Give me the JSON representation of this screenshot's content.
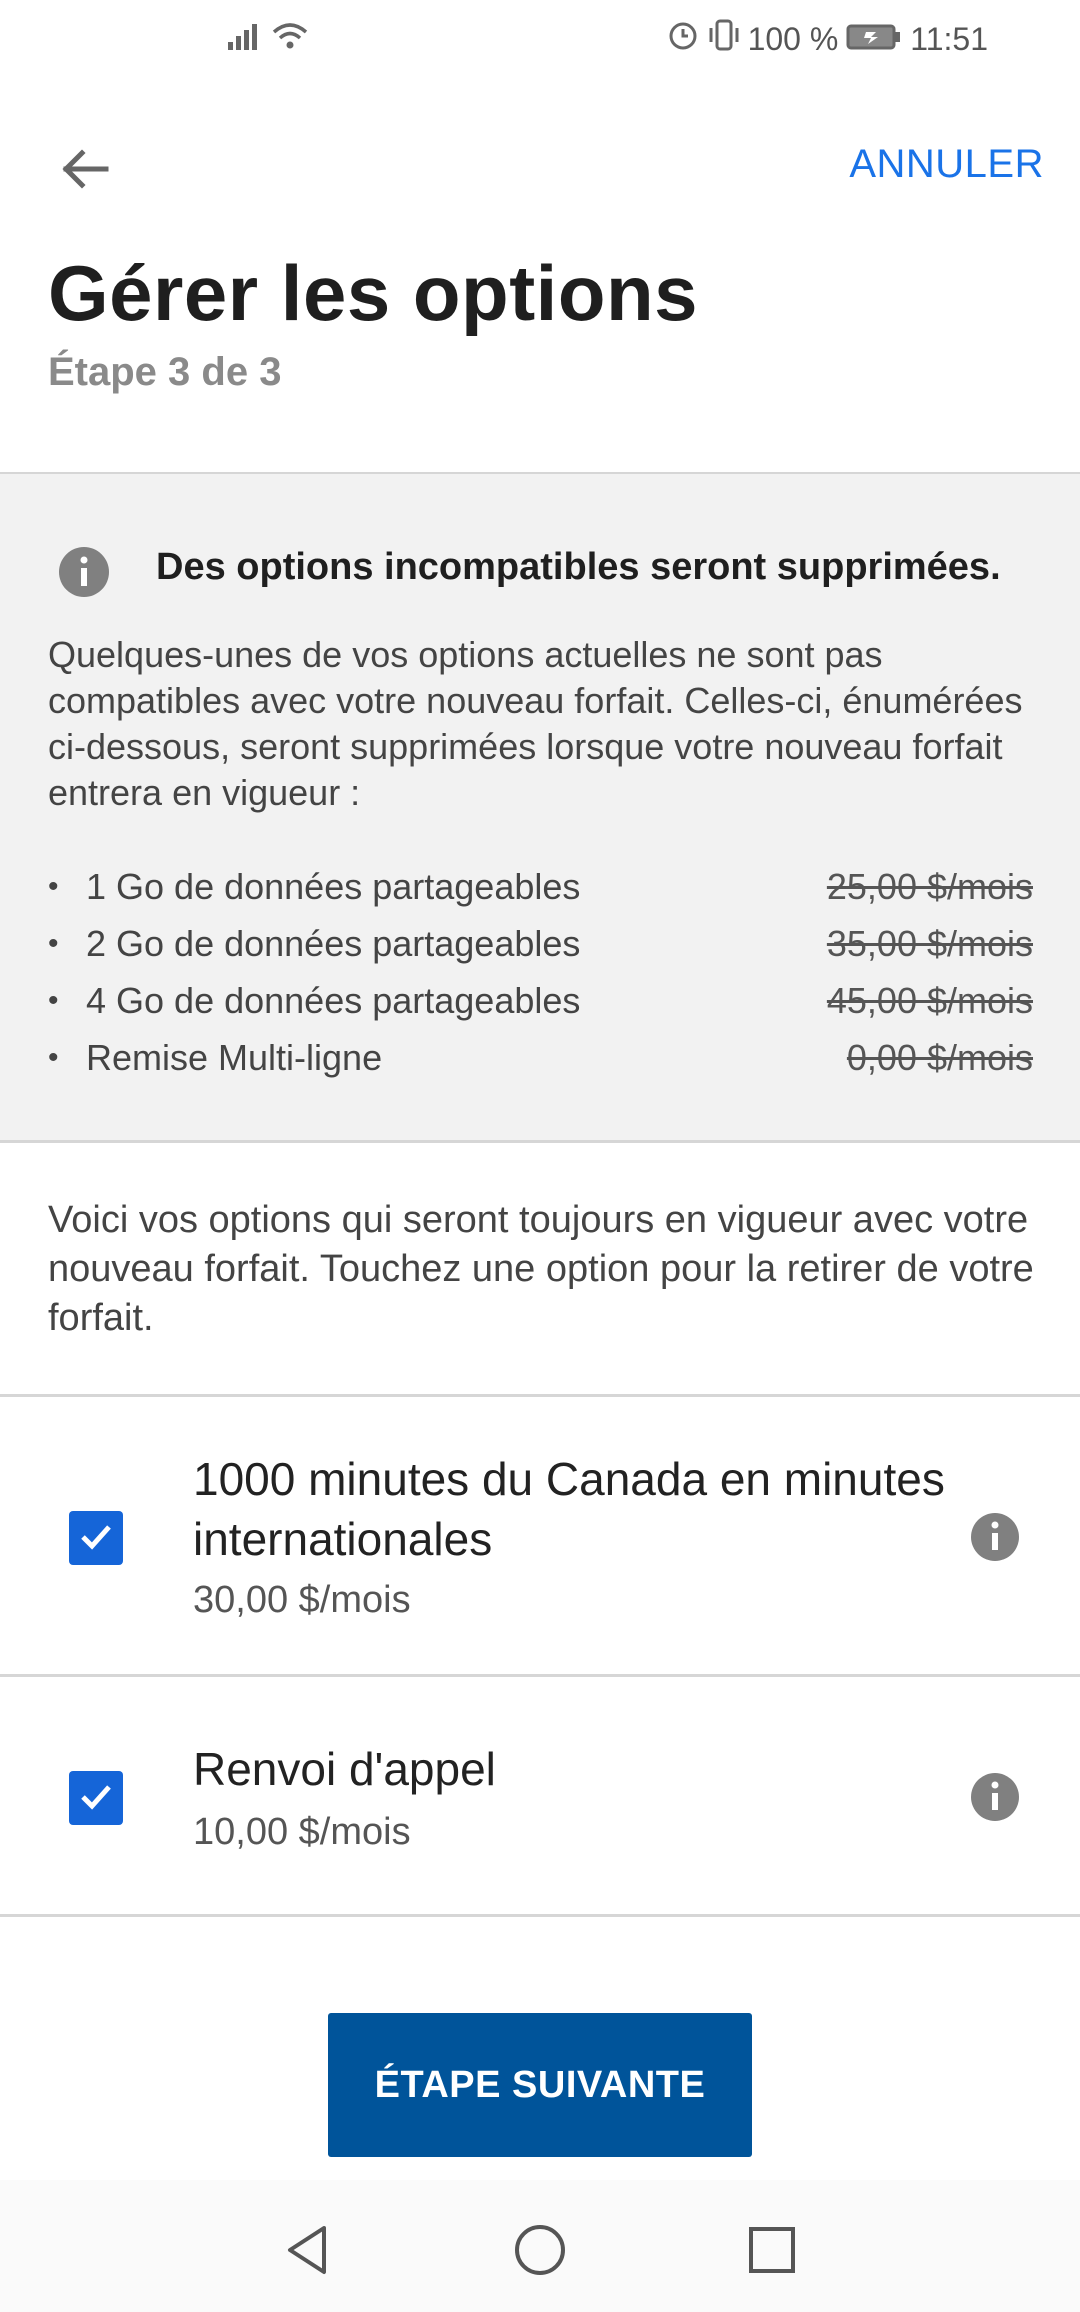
{
  "status_bar": {
    "battery_percent": "100 %",
    "time": "11:51"
  },
  "header": {
    "cancel_label": "ANNULER",
    "title": "Gérer les options",
    "subtitle": "Étape 3 de 3"
  },
  "warning": {
    "title": "Des options incompatibles seront supprimées.",
    "body": "Quelques-unes de vos options actuelles ne sont pas compatibles avec votre nouveau forfait. Celles-ci, énumérées ci-dessous, seront supprimées lorsque votre nouveau forfait entrera en vigueur :",
    "items": [
      {
        "name": "1 Go de données partageables",
        "price": "25,00 $/mois"
      },
      {
        "name": "2 Go de données partageables",
        "price": "35,00 $/mois"
      },
      {
        "name": "4 Go de données partageables",
        "price": "45,00 $/mois"
      },
      {
        "name": "Remise Multi-ligne",
        "price": "0,00 $/mois"
      }
    ]
  },
  "info_text": "Voici vos options qui seront toujours en vigueur avec votre nouveau forfait. Touchez une option pour la retirer de votre forfait.",
  "options": [
    {
      "title": "1000 minutes du Canada en minutes internationales",
      "price": "30,00 $/mois",
      "checked": true
    },
    {
      "title": "Renvoi d'appel",
      "price": "10,00 $/mois",
      "checked": true
    }
  ],
  "next_button_label": "ÉTAPE SUIVANTE",
  "colors": {
    "accent": "#1a73e8",
    "checkbox": "#1565d8",
    "primary_button": "#00549a",
    "panel_bg": "#f2f2f2"
  },
  "icons": {
    "back": "arrow-left-icon",
    "info": "info-icon",
    "check": "check-icon",
    "nav_back": "triangle-back-icon",
    "nav_home": "circle-home-icon",
    "nav_recents": "square-recents-icon"
  }
}
